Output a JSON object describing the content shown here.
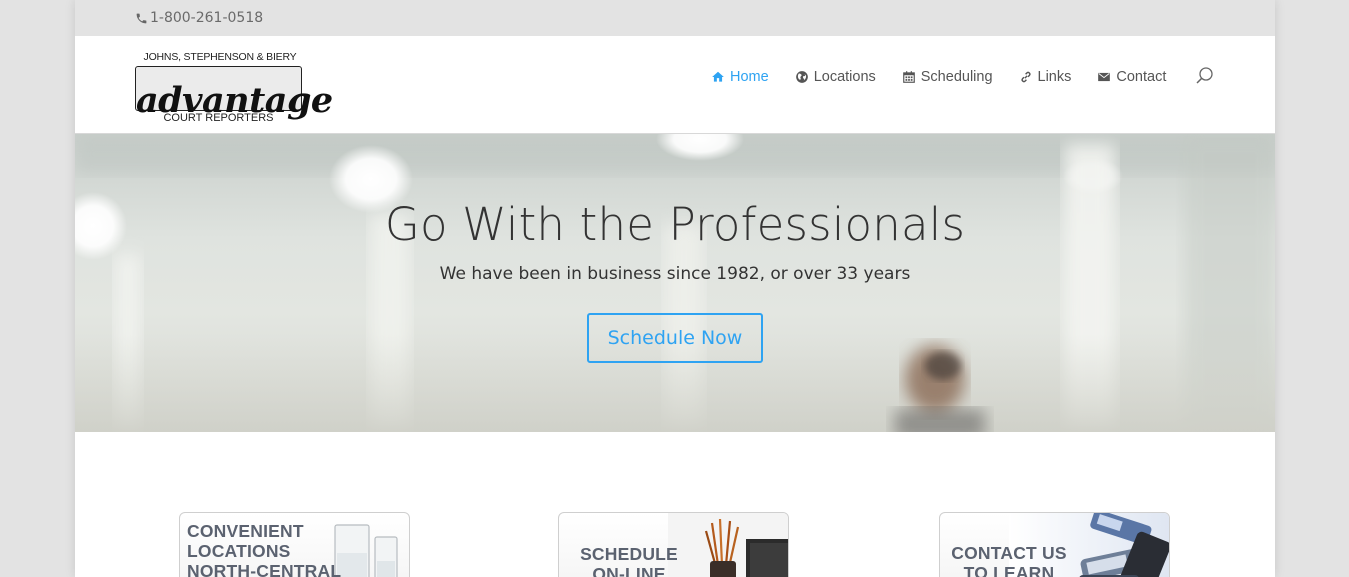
{
  "topbar": {
    "phone": "1-800-261-0518",
    "phone_icon": "phone-icon"
  },
  "logo": {
    "top_line": "JOHNS, STEPHENSON & BIERY",
    "word": "advantage",
    "bottom_line": "COURT REPORTERS"
  },
  "nav": {
    "items": [
      {
        "label": "Home",
        "icon": "home-icon",
        "active": true
      },
      {
        "label": "Locations",
        "icon": "globe-icon"
      },
      {
        "label": "Scheduling",
        "icon": "calendar-icon"
      },
      {
        "label": "Links",
        "icon": "link-icon"
      },
      {
        "label": "Contact",
        "icon": "envelope-icon"
      }
    ],
    "search_icon": "search-icon"
  },
  "hero": {
    "title": "Go With the Professionals",
    "subtitle": "We have been in business since 1982, or over 33 years",
    "button": "Schedule Now"
  },
  "cards": [
    {
      "text": "CONVENIENT\nLOCATIONS\nNORTH-CENTRAL"
    },
    {
      "text": "SCHEDULE\nON-LINE NOW"
    },
    {
      "text": "CONTACT US\nTO LEARN"
    }
  ],
  "colors": {
    "accent": "#2ea3f2",
    "text": "#333333",
    "nav_text": "#555555",
    "topbar_bg": "#e3e3e3"
  }
}
